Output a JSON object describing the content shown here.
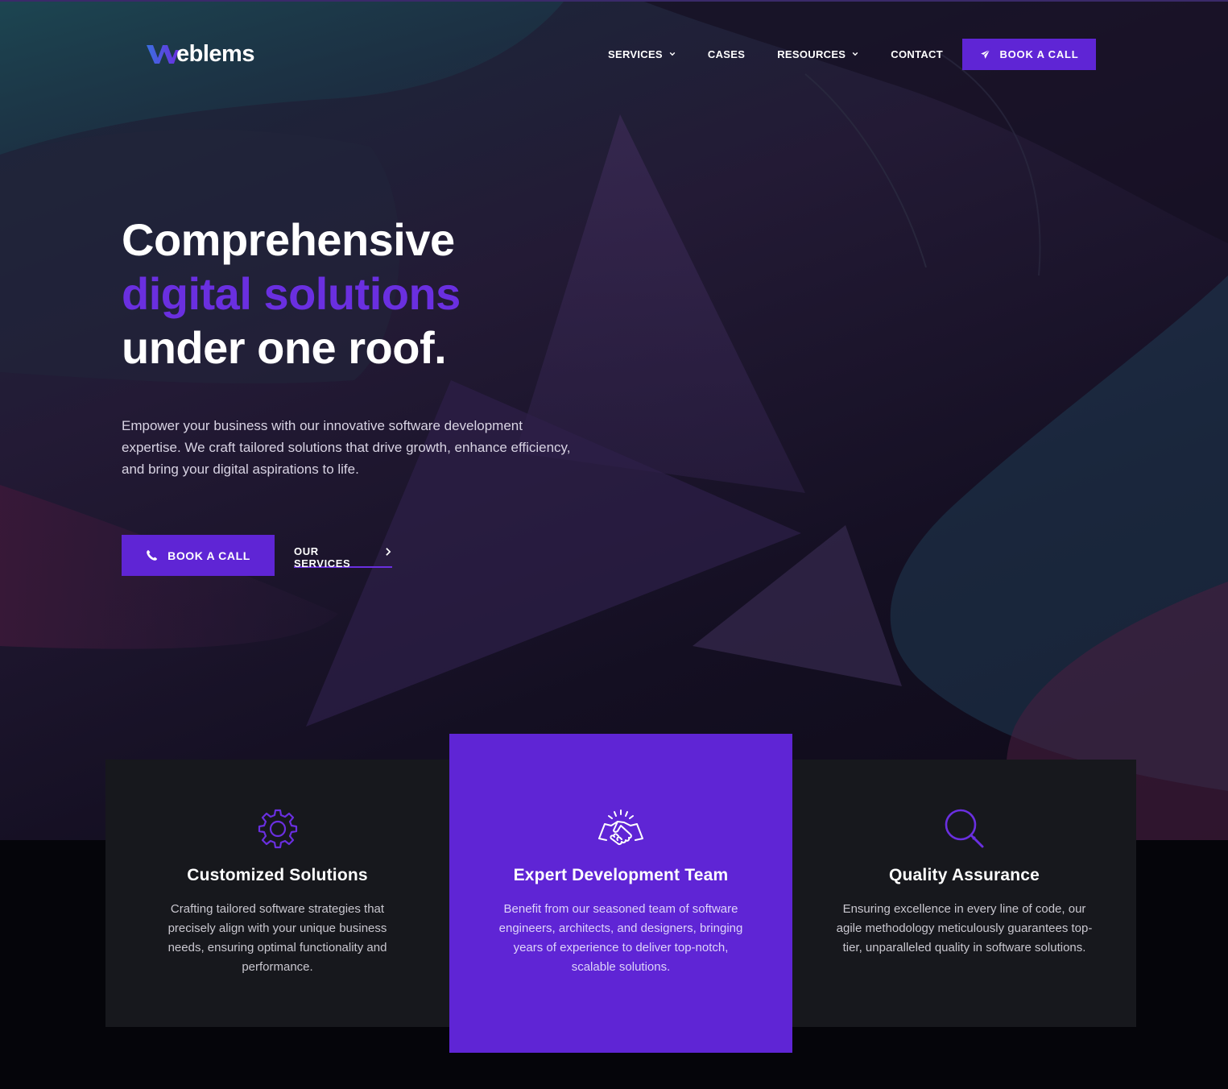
{
  "brand": {
    "name": "eblems",
    "accent": "#5f25d5",
    "headline_accent": "#6a2fe0"
  },
  "nav": {
    "items": [
      {
        "label": "SERVICES",
        "dropdown": true
      },
      {
        "label": "CASES",
        "dropdown": false
      },
      {
        "label": "RESOURCES",
        "dropdown": true
      },
      {
        "label": "CONTACT",
        "dropdown": false
      }
    ],
    "cta": {
      "label": "BOOK A CALL",
      "icon": "paper-plane-icon"
    }
  },
  "hero": {
    "title_line1": "Comprehensive",
    "title_line2": "digital solutions",
    "title_line3": "under one roof.",
    "lead": "Empower your business with our innovative software development expertise. We craft tailored solutions that drive growth, enhance efficiency, and bring your digital aspirations to life.",
    "primary_button": {
      "label": "BOOK A CALL",
      "icon": "phone-icon"
    },
    "secondary_link": {
      "label": "OUR SERVICES",
      "icon": "chevron-right-icon"
    }
  },
  "features": [
    {
      "icon": "gear-icon",
      "title": "Customized Solutions",
      "text": "Crafting tailored software strategies that precisely align with your unique business needs, ensuring optimal functionality and performance."
    },
    {
      "icon": "handshake-icon",
      "title": "Expert Development Team",
      "text": "Benefit from our seasoned team of software engineers, architects, and designers, bringing years of experience to deliver top-notch, scalable solutions."
    },
    {
      "icon": "magnifier-icon",
      "title": "Quality Assurance",
      "text": "Ensuring excellence in every line of code, our agile methodology meticulously guarantees top-tier, unparalleled quality in software solutions."
    }
  ]
}
